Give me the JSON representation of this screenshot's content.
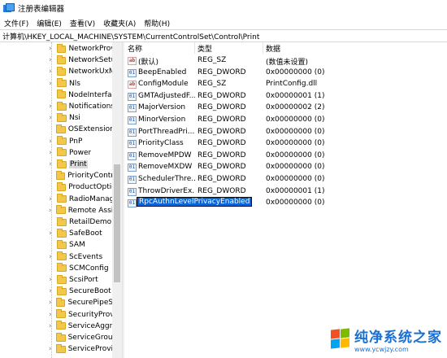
{
  "window": {
    "title": "注册表编辑器"
  },
  "menu": [
    "文件(F)",
    "编辑(E)",
    "查看(V)",
    "收藏夹(A)",
    "帮助(H)"
  ],
  "address": "计算机\\HKEY_LOCAL_MACHINE\\SYSTEM\\CurrentControlSet\\Control\\Print",
  "tree": {
    "items": [
      {
        "label": "NetworkProv",
        "expandable": true
      },
      {
        "label": "NetworkSetu",
        "expandable": true
      },
      {
        "label": "NetworkUxM",
        "expandable": true
      },
      {
        "label": "Nls",
        "expandable": true
      },
      {
        "label": "NodeInterfac",
        "expandable": false
      },
      {
        "label": "Notifications",
        "expandable": true
      },
      {
        "label": "Nsi",
        "expandable": true
      },
      {
        "label": "OSExtensionI",
        "expandable": false
      },
      {
        "label": "PnP",
        "expandable": true
      },
      {
        "label": "Power",
        "expandable": true
      },
      {
        "label": "Print",
        "expandable": true,
        "selected": true
      },
      {
        "label": "PriorityContro",
        "expandable": false
      },
      {
        "label": "ProductOptic",
        "expandable": false
      },
      {
        "label": "RadioManag",
        "expandable": true
      },
      {
        "label": "Remote Assis",
        "expandable": true
      },
      {
        "label": "RetailDemo",
        "expandable": false
      },
      {
        "label": "SafeBoot",
        "expandable": true
      },
      {
        "label": "SAM",
        "expandable": false
      },
      {
        "label": "ScEvents",
        "expandable": true
      },
      {
        "label": "SCMConfig",
        "expandable": false
      },
      {
        "label": "ScsiPort",
        "expandable": true
      },
      {
        "label": "SecureBoot",
        "expandable": true
      },
      {
        "label": "SecurePipeSe",
        "expandable": true
      },
      {
        "label": "SecurityProvi",
        "expandable": true
      },
      {
        "label": "ServiceAggre",
        "expandable": true
      },
      {
        "label": "ServiceGroup",
        "expandable": false
      },
      {
        "label": "ServiceProvic",
        "expandable": true
      }
    ]
  },
  "columns": {
    "name": "名称",
    "type": "类型",
    "data": "数据"
  },
  "values": [
    {
      "icon": "ab",
      "name": "(默认)",
      "type": "REG_SZ",
      "data": "(数值未设置)"
    },
    {
      "icon": "dw",
      "name": "BeepEnabled",
      "type": "REG_DWORD",
      "data": "0x00000000 (0)"
    },
    {
      "icon": "ab",
      "name": "ConfigModule",
      "type": "REG_SZ",
      "data": "PrintConfig.dll"
    },
    {
      "icon": "dw",
      "name": "GMTAdjustedF...",
      "type": "REG_DWORD",
      "data": "0x00000001 (1)"
    },
    {
      "icon": "dw",
      "name": "MajorVersion",
      "type": "REG_DWORD",
      "data": "0x00000002 (2)"
    },
    {
      "icon": "dw",
      "name": "MinorVersion",
      "type": "REG_DWORD",
      "data": "0x00000000 (0)"
    },
    {
      "icon": "dw",
      "name": "PortThreadPri...",
      "type": "REG_DWORD",
      "data": "0x00000000 (0)"
    },
    {
      "icon": "dw",
      "name": "PriorityClass",
      "type": "REG_DWORD",
      "data": "0x00000000 (0)"
    },
    {
      "icon": "dw",
      "name": "RemoveMPDW",
      "type": "REG_DWORD",
      "data": "0x00000000 (0)"
    },
    {
      "icon": "dw",
      "name": "RemoveMXDW",
      "type": "REG_DWORD",
      "data": "0x00000000 (0)"
    },
    {
      "icon": "dw",
      "name": "SchedulerThre...",
      "type": "REG_DWORD",
      "data": "0x00000000 (0)"
    },
    {
      "icon": "dw",
      "name": "ThrowDriverEx...",
      "type": "REG_DWORD",
      "data": "0x00000001 (1)"
    },
    {
      "icon": "dw",
      "name": "RpcAuthnLevelPrivacyEnabled",
      "type": "",
      "data": "0x00000000 (0)",
      "editing": true
    }
  ],
  "watermark": {
    "title": "纯净系统之家",
    "url": "www.ycwjzy.com"
  }
}
